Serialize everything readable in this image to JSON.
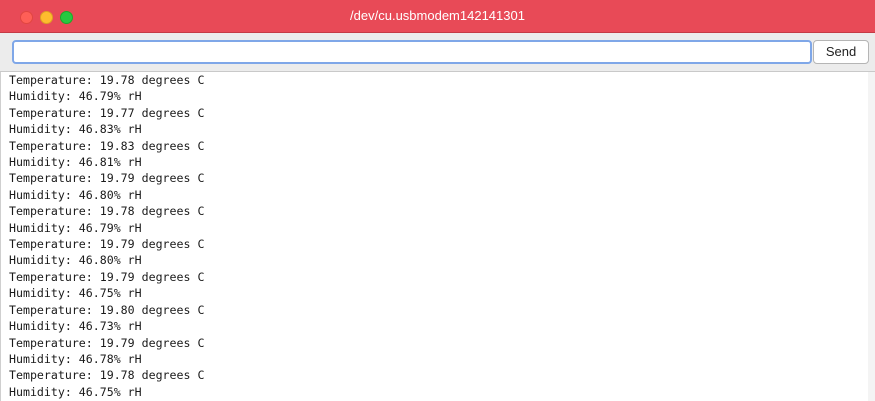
{
  "window": {
    "title": "/dev/cu.usbmodem142141301"
  },
  "toolbar": {
    "input_value": "",
    "send_label": "Send"
  },
  "output": {
    "lines": [
      "Temperature: 19.78 degrees C",
      "Humidity: 46.79% rH",
      "Temperature: 19.77 degrees C",
      "Humidity: 46.83% rH",
      "Temperature: 19.83 degrees C",
      "Humidity: 46.81% rH",
      "Temperature: 19.79 degrees C",
      "Humidity: 46.80% rH",
      "Temperature: 19.78 degrees C",
      "Humidity: 46.79% rH",
      "Temperature: 19.79 degrees C",
      "Humidity: 46.80% rH",
      "Temperature: 19.79 degrees C",
      "Humidity: 46.75% rH",
      "Temperature: 19.80 degrees C",
      "Humidity: 46.73% rH",
      "Temperature: 19.79 degrees C",
      "Humidity: 46.78% rH",
      "Temperature: 19.78 degrees C",
      "Humidity: 46.75% rH"
    ]
  },
  "colors": {
    "titlebar": "#e84a57",
    "close": "#ff5f57",
    "minimize": "#febc2e",
    "zoom": "#28c840",
    "input_focus_ring": "#7fa7e8"
  }
}
